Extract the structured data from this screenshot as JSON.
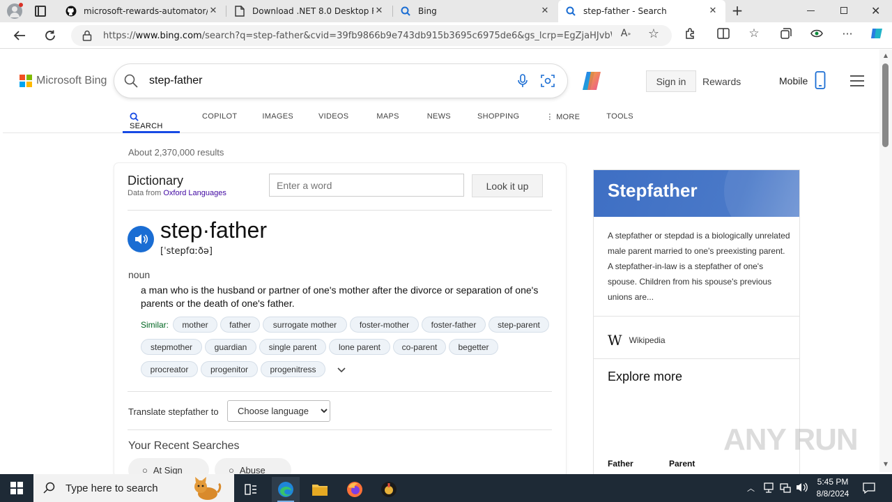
{
  "browser": {
    "tabs": [
      {
        "title": "microsoft-rewards-automator/M",
        "icon": "github-icon"
      },
      {
        "title": "Download .NET 8.0 Desktop Runt",
        "icon": "page-icon"
      },
      {
        "title": "Bing",
        "icon": "search-icon"
      },
      {
        "title": "step-father - Search",
        "icon": "search-icon",
        "active": true
      }
    ],
    "url_prefix": "https://",
    "url_host": "www.bing.com",
    "url_rest": "/search?q=step-father&cvid=39fb9866b9e743db915b3695c6975de6&gs_lcrp=EgZjaHJvbWUy..."
  },
  "bing": {
    "logo_text": "Microsoft Bing",
    "query": "step-father",
    "signin_label": "Sign in",
    "rewards_label": "Rewards",
    "mobile_label": "Mobile",
    "scopes": [
      "SEARCH",
      "COPILOT",
      "IMAGES",
      "VIDEOS",
      "MAPS",
      "NEWS",
      "SHOPPING",
      "MORE",
      "TOOLS"
    ],
    "results_count": "About 2,370,000 results"
  },
  "dictionary": {
    "title": "Dictionary",
    "source_prefix": "Data from ",
    "source_link": "Oxford Languages",
    "word_placeholder": "Enter a word",
    "lookup_label": "Look it up",
    "headword": "step·father",
    "pronunciation": "[ˈstepfɑːðə]",
    "part_of_speech": "noun",
    "definition": "a man who is the husband or partner of one's mother after the divorce or separation of one's parents or the death of one's father.",
    "similar_label": "Similar:",
    "similar": [
      "mother",
      "father",
      "surrogate mother",
      "foster-mother",
      "foster-father",
      "step-parent",
      "stepmother",
      "guardian",
      "single parent",
      "lone parent",
      "co-parent",
      "begetter",
      "procreator",
      "progenitor",
      "progenitress"
    ],
    "translate_label": "Translate stepfather to",
    "language_option": "Choose language",
    "recent_title": "Your Recent Searches",
    "recent": [
      "At Sign",
      "Abuse"
    ]
  },
  "side_panel": {
    "title": "Stepfather",
    "description": "A stepfather or stepdad is a biologically unrelated male parent married to one's preexisting parent. A stepfather-in-law is a stepfather of one's spouse. Children from his spouse's previous unions are...",
    "source": "Wikipedia",
    "explore_title": "Explore more",
    "explore_items": [
      "Father",
      "Parent"
    ]
  },
  "watermark": "ANY RUN",
  "taskbar": {
    "search_placeholder": "Type here to search",
    "time": "5:45 PM",
    "date": "8/8/2024"
  },
  "colors": {
    "bing_accent": "#174ae4",
    "side_banner": "#4a79c8",
    "taskbar": "#1e2a36"
  }
}
